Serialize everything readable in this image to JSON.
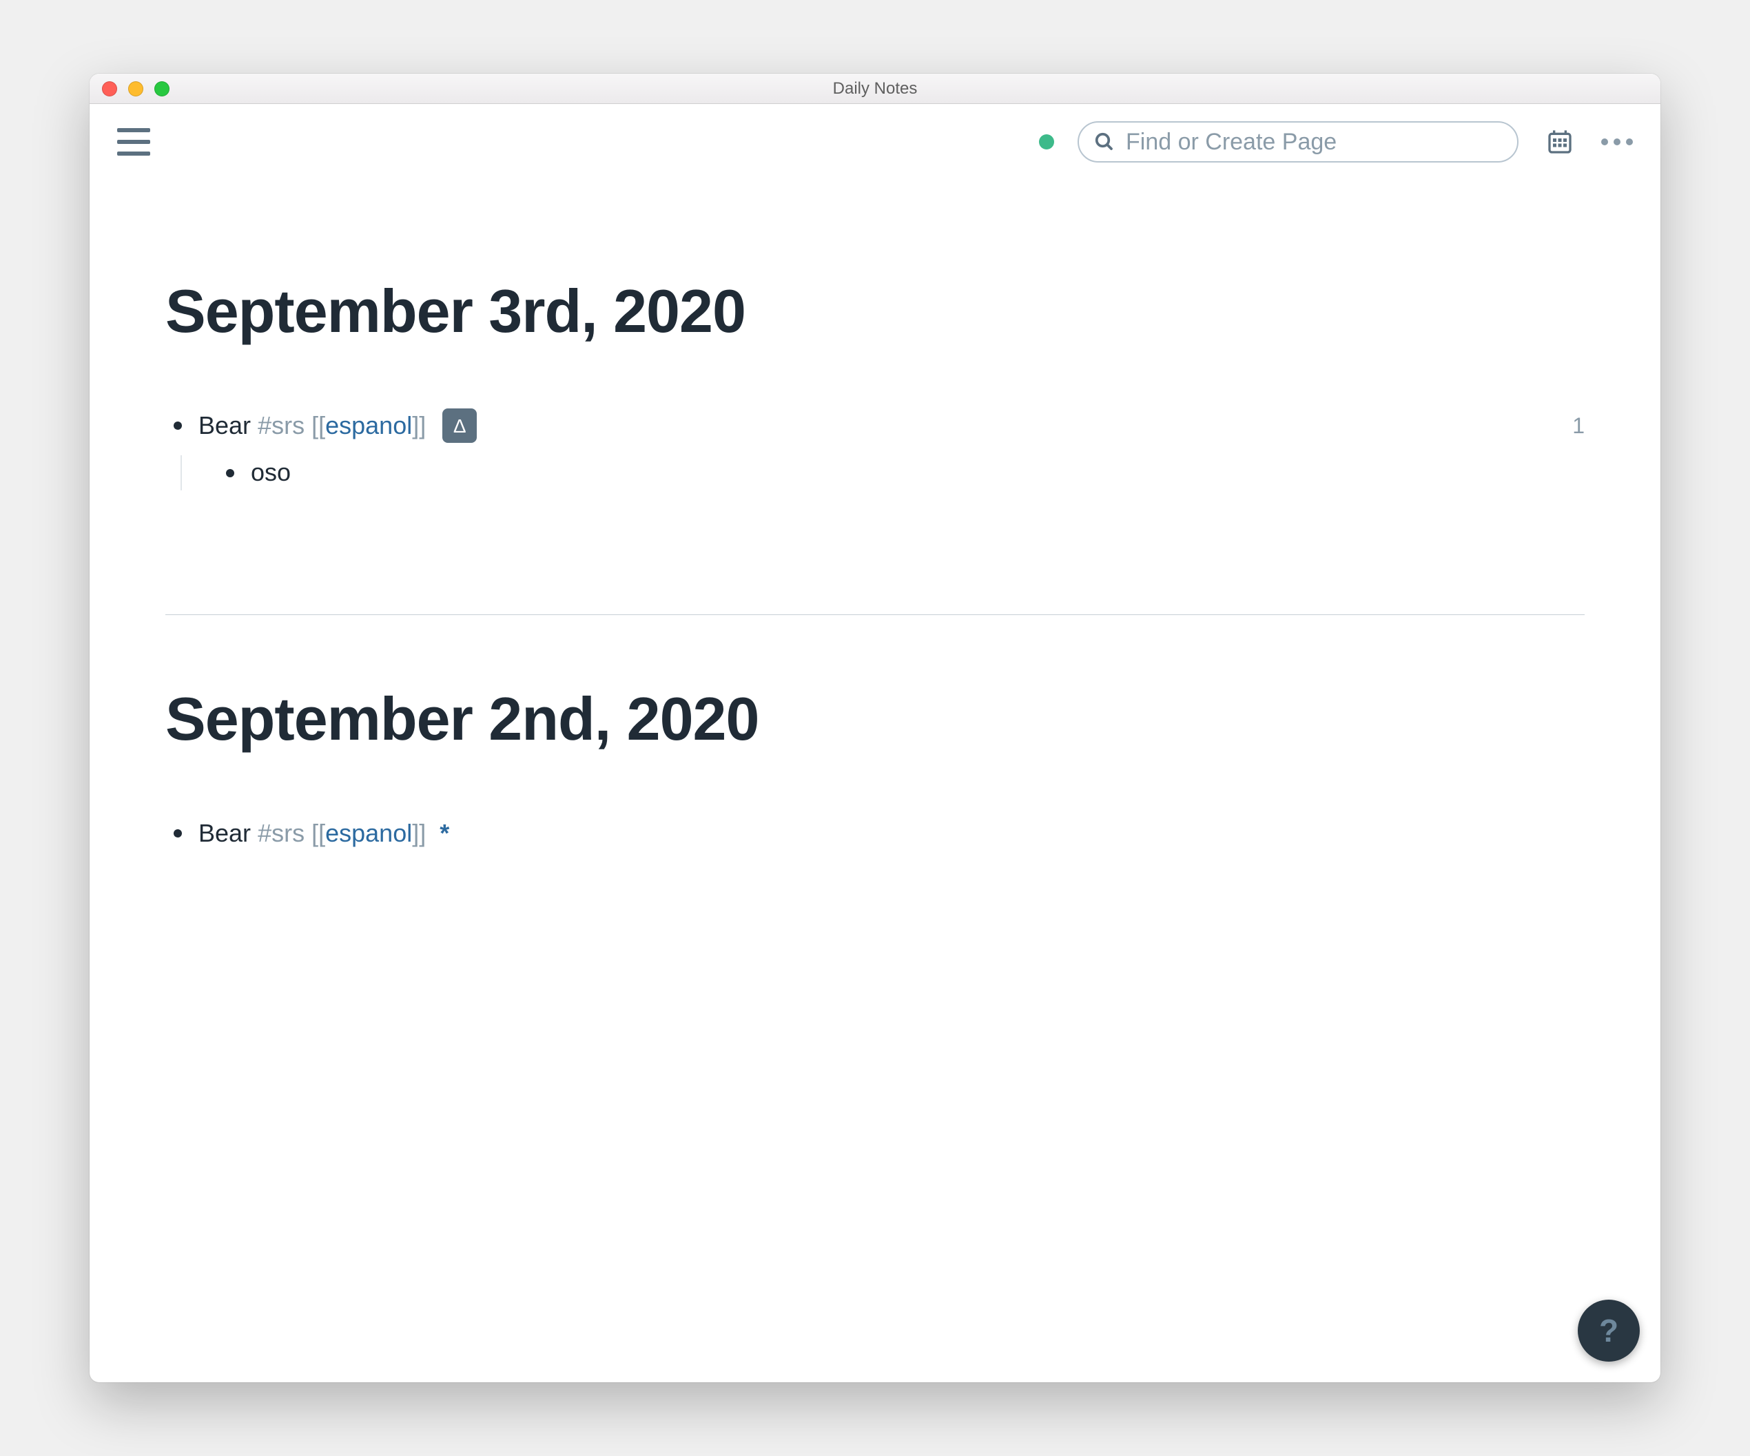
{
  "window": {
    "title": "Daily Notes"
  },
  "toolbar": {
    "search_placeholder": "Find or Create Page",
    "sync_status": "synced"
  },
  "days": [
    {
      "title": "September 3rd, 2020",
      "ref_count": "1",
      "block": {
        "text": "Bear",
        "tag": "#srs",
        "link_open": "[[",
        "link_text": "espanol",
        "link_close": "]]",
        "badge": "Δ",
        "children": [
          {
            "text": "oso"
          }
        ]
      }
    },
    {
      "title": "September 2nd, 2020",
      "block": {
        "text": "Bear",
        "tag": "#srs",
        "link_open": "[[",
        "link_text": "espanol",
        "link_close": "]]",
        "star": "*"
      }
    }
  ],
  "help_label": "?"
}
